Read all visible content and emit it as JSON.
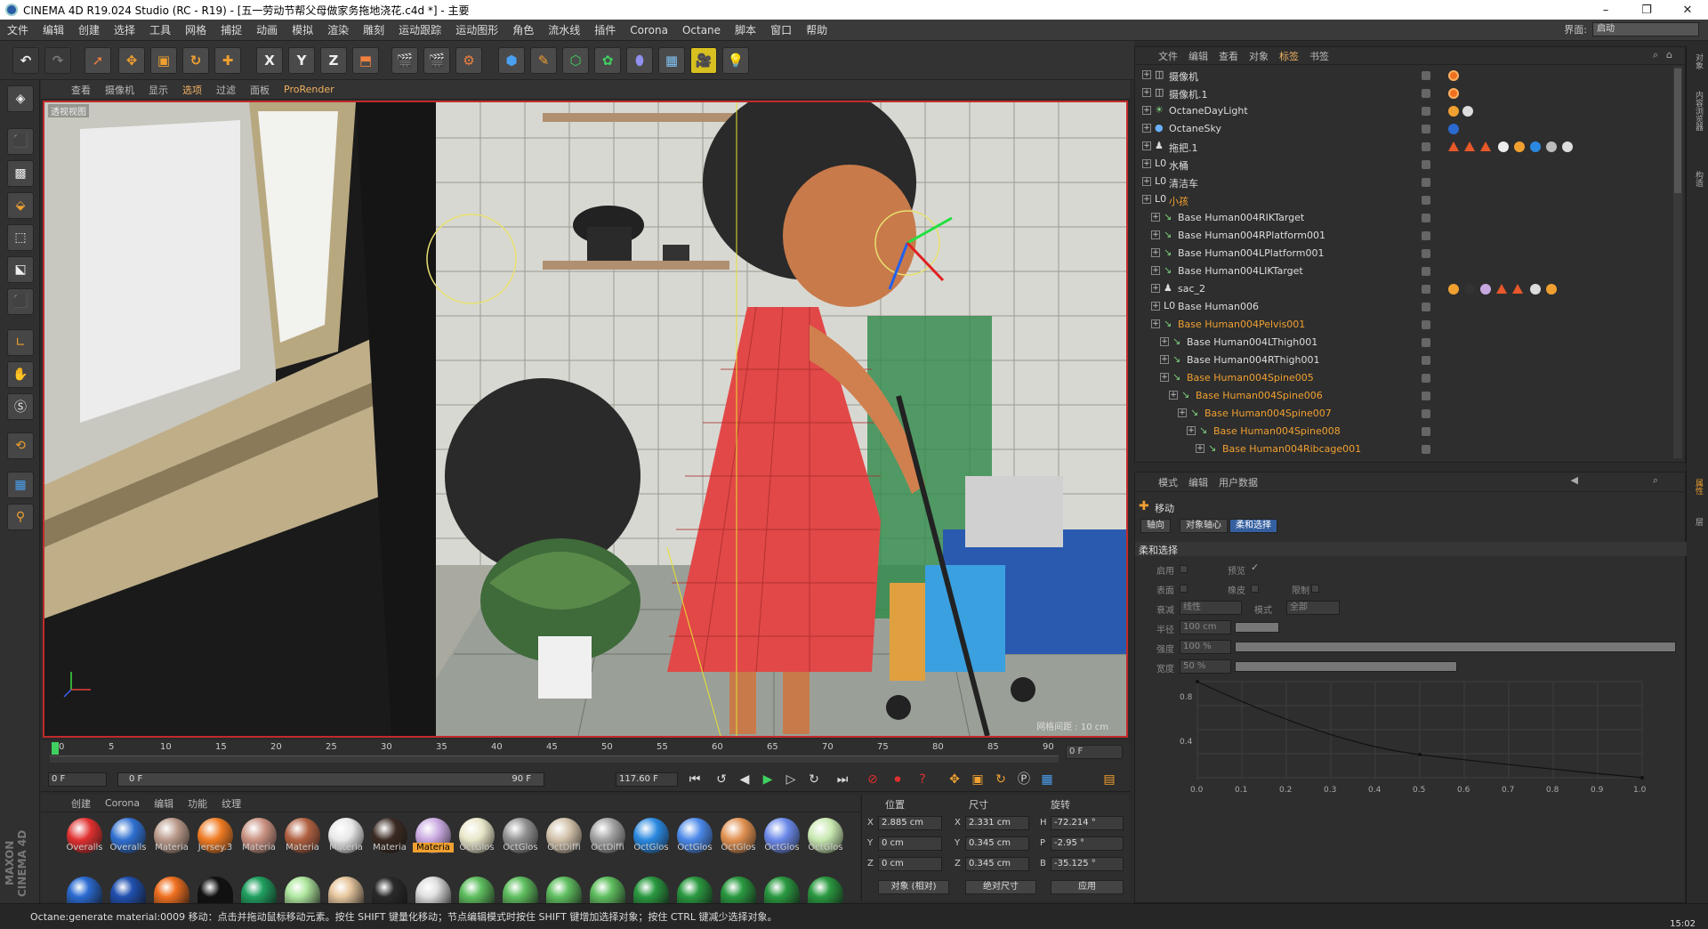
{
  "titlebar": {
    "title": "CINEMA 4D R19.024 Studio (RC - R19) - [五一劳动节帮父母做家务拖地浇花.c4d *] - 主要",
    "minimize": "–",
    "maximize": "❐",
    "close": "✕"
  },
  "menubar": {
    "items": [
      "文件",
      "编辑",
      "创建",
      "选择",
      "工具",
      "网格",
      "捕捉",
      "动画",
      "模拟",
      "渲染",
      "雕刻",
      "运动跟踪",
      "运动图形",
      "角色",
      "流水线",
      "插件",
      "Corona",
      "Octane",
      "脚本",
      "窗口",
      "帮助"
    ],
    "layout_label": "界面:",
    "layout_value": "启动"
  },
  "maintoolbar": {
    "axis_buttons": [
      "X",
      "Y",
      "Z"
    ]
  },
  "viewport": {
    "menu": [
      "查看",
      "摄像机",
      "显示",
      "选项",
      "过滤",
      "面板",
      "ProRender"
    ],
    "active_menu": "选项",
    "label": "透视视图",
    "grid_info": "网格间距 : 10 cm"
  },
  "timeline": {
    "ticks": [
      "0",
      "5",
      "10",
      "15",
      "20",
      "25",
      "30",
      "35",
      "40",
      "45",
      "50",
      "55",
      "60",
      "65",
      "70",
      "75",
      "80",
      "85",
      "90"
    ],
    "frame_end": "0 F"
  },
  "transport": {
    "start": "0 F",
    "range_start": "0 F",
    "range_end": "90 F",
    "current": "117.60 F"
  },
  "material_manager": {
    "menu": [
      "创建",
      "Corona",
      "编辑",
      "功能",
      "纹理"
    ],
    "materials": [
      {
        "name": "Overalls",
        "color": "#e03030"
      },
      {
        "name": "Overalls",
        "color": "#2f6fd0"
      },
      {
        "name": "Materia",
        "color": "#b89888"
      },
      {
        "name": "Jersey.3",
        "color": "#ee7a22"
      },
      {
        "name": "Materia",
        "color": "#c89080"
      },
      {
        "name": "Materia",
        "color": "#b06040"
      },
      {
        "name": "Materia",
        "color": "#e8e8e8"
      },
      {
        "name": "Materia",
        "color": "#3a2a22"
      },
      {
        "name": "Materia",
        "color": "#c8a8e0"
      },
      {
        "name": "OctGlos",
        "color": "#e8e6c8"
      },
      {
        "name": "OctGlos",
        "color": "#909090"
      },
      {
        "name": "OctDiffi",
        "color": "#d0c0a8"
      },
      {
        "name": "OctDiffi",
        "color": "#a0a0a0"
      },
      {
        "name": "OctGlos",
        "color": "#2a88e0"
      },
      {
        "name": "OctGlos",
        "color": "#4a88e8"
      },
      {
        "name": "OctGlos",
        "color": "#e09050"
      },
      {
        "name": "OctGlos",
        "color": "#6a88e8"
      },
      {
        "name": "OctGlos",
        "color": "#c8e8b0"
      }
    ],
    "selected_index": 8,
    "row2_colors": [
      "#2a6ad0",
      "#2050b0",
      "#f07020",
      "#111111",
      "#20a060",
      "#b0e8a0",
      "#e8c8a0",
      "#2a2a2a",
      "#e0e0e0",
      "#60c060",
      "#60c060",
      "#60c060",
      "#60c060",
      "#2a9a40",
      "#2a9a40",
      "#2a9a40",
      "#2a9a40",
      "#2a9a40"
    ]
  },
  "coordinates": {
    "headers": [
      "位置",
      "尺寸",
      "旋转"
    ],
    "rows": [
      {
        "axis": "X",
        "pos": "2.885 cm",
        "size_axis": "X",
        "size": "2.331 cm",
        "rot_axis": "H",
        "rot": "-72.214 °"
      },
      {
        "axis": "Y",
        "pos": "0 cm",
        "size_axis": "Y",
        "size": "0.345 cm",
        "rot_axis": "P",
        "rot": "-2.95 °"
      },
      {
        "axis": "Z",
        "pos": "0 cm",
        "size_axis": "Z",
        "size": "0.345 cm",
        "rot_axis": "B",
        "rot": "-35.125 °"
      }
    ],
    "mode": "对象 (相对)",
    "size_mode": "绝对尺寸",
    "apply": "应用"
  },
  "object_manager": {
    "menu": [
      "文件",
      "编辑",
      "查看",
      "对象",
      "标签",
      "书签"
    ],
    "active_menu": "标签",
    "rows": [
      {
        "name": "摄像机",
        "indent": 0,
        "icon": "camera",
        "hl": false
      },
      {
        "name": "摄像机.1",
        "indent": 0,
        "icon": "camera",
        "hl": false
      },
      {
        "name": "OctaneDayLight",
        "indent": 0,
        "icon": "light",
        "hl": false
      },
      {
        "name": "OctaneSky",
        "indent": 0,
        "icon": "sky",
        "hl": false
      },
      {
        "name": "拖把.1",
        "indent": 0,
        "icon": "figure",
        "hl": false
      },
      {
        "name": "水桶",
        "indent": 0,
        "icon": "null",
        "hl": false
      },
      {
        "name": "清洁车",
        "indent": 0,
        "icon": "null",
        "hl": false
      },
      {
        "name": "小孩",
        "indent": 0,
        "icon": "null",
        "hl": true
      },
      {
        "name": "Base Human004RIKTarget",
        "indent": 1,
        "icon": "bone",
        "hl": false
      },
      {
        "name": "Base Human004RPlatform001",
        "indent": 1,
        "icon": "bone",
        "hl": false
      },
      {
        "name": "Base Human004LPlatform001",
        "indent": 1,
        "icon": "bone",
        "hl": false
      },
      {
        "name": "Base Human004LIKTarget",
        "indent": 1,
        "icon": "bone",
        "hl": false
      },
      {
        "name": "sac_2",
        "indent": 1,
        "icon": "figure",
        "hl": false
      },
      {
        "name": "Base Human006",
        "indent": 1,
        "icon": "null",
        "hl": false
      },
      {
        "name": "Base Human004Pelvis001",
        "indent": 1,
        "icon": "bone",
        "hl": true
      },
      {
        "name": "Base Human004LThigh001",
        "indent": 2,
        "icon": "bone",
        "hl": false
      },
      {
        "name": "Base Human004RThigh001",
        "indent": 2,
        "icon": "bone",
        "hl": false
      },
      {
        "name": "Base Human004Spine005",
        "indent": 2,
        "icon": "bone",
        "hl": true
      },
      {
        "name": "Base Human004Spine006",
        "indent": 3,
        "icon": "bone",
        "hl": true
      },
      {
        "name": "Base Human004Spine007",
        "indent": 4,
        "icon": "bone",
        "hl": true
      },
      {
        "name": "Base Human004Spine008",
        "indent": 5,
        "icon": "bone",
        "hl": true
      },
      {
        "name": "Base Human004Ribcage001",
        "indent": 6,
        "icon": "bone",
        "hl": true
      }
    ]
  },
  "attribute_manager": {
    "menu": [
      "模式",
      "编辑",
      "用户数据"
    ],
    "tool_name": "移动",
    "tabs": [
      "轴向",
      "对象轴心",
      "柔和选择"
    ],
    "active_tab": "柔和选择",
    "section": "柔和选择",
    "labels": {
      "enable": "启用",
      "preview": "预览",
      "surface": "表面",
      "rubber": "橡皮",
      "restrict": "限制",
      "falloff": "衰减",
      "falloff_value": "线性",
      "mode": "模式",
      "mode_value": "全部",
      "radius": "半径",
      "radius_value": "100 cm",
      "strength": "强度",
      "strength_value": "100 %",
      "width": "宽度",
      "width_value": "50 %"
    },
    "curve_y": [
      "0.8",
      "0.4"
    ],
    "curve_x": [
      "0.0",
      "0.1",
      "0.2",
      "0.3",
      "0.4",
      "0.5",
      "0.6",
      "0.7",
      "0.8",
      "0.9",
      "1.0"
    ]
  },
  "right_dock": [
    "对象",
    "内容浏览器",
    "构造",
    "属性",
    "层"
  ],
  "status": "Octane:generate material:0009      移动：点击并拖动鼠标移动元素。按住 SHIFT 键量化移动；节点编辑模式时按住 SHIFT 键增加选择对象；按住 CTRL 键减少选择对象。",
  "clock": "15:02"
}
